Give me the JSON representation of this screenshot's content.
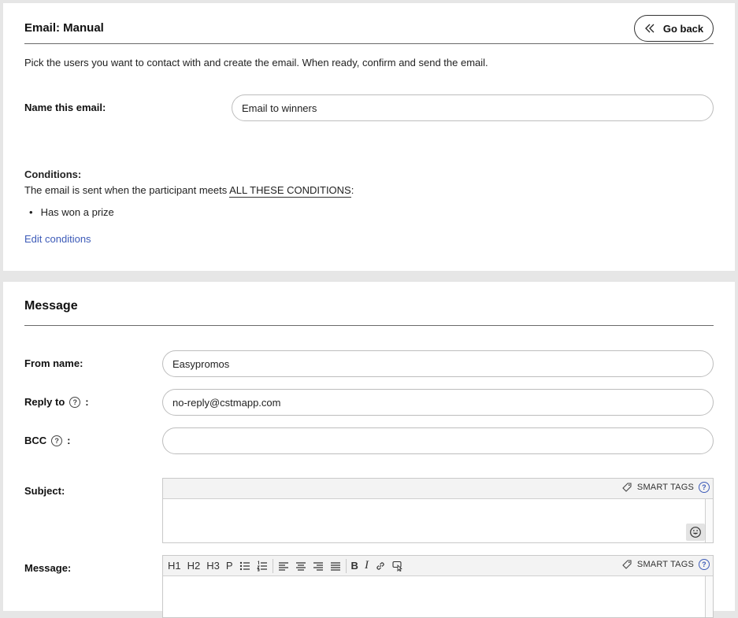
{
  "header": {
    "title": "Email: Manual",
    "go_back_label": "Go back",
    "description": "Pick the users you want to contact with and create the email. When ready, confirm and send the email."
  },
  "name_field": {
    "label": "Name this email:",
    "value": "Email to winners"
  },
  "conditions": {
    "heading": "Conditions:",
    "text_prefix": "The email is sent when the participant meets ",
    "text_emphasis": "ALL THESE CONDITIONS",
    "text_suffix": ":",
    "items": [
      "Has won a prize"
    ],
    "edit_link": "Edit conditions"
  },
  "message": {
    "title": "Message",
    "from_label": "From name:",
    "from_value": "Easypromos",
    "reply_label": "Reply to",
    "reply_value": "no-reply@cstmapp.com",
    "bcc_label": "BCC",
    "bcc_value": "",
    "colon": ":",
    "help_glyph": "?",
    "subject_label": "Subject:",
    "message_label": "Message:",
    "smart_tags_label": "SMART TAGS",
    "toolbar": {
      "h1": "H1",
      "h2": "H2",
      "h3": "H3",
      "p": "P",
      "bold": "B",
      "italic": "I"
    }
  },
  "colors": {
    "accent": "#3d5bb8",
    "page_bg": "#e6e6e6",
    "rule": "#6a6a6a"
  }
}
